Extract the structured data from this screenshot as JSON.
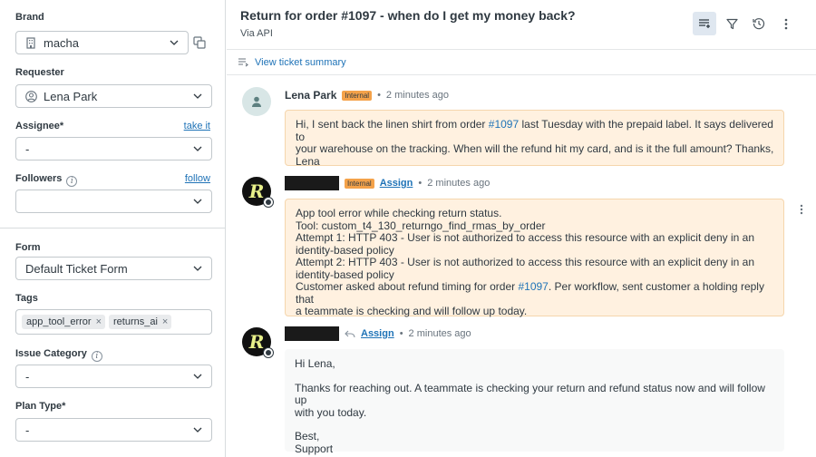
{
  "sidebar": {
    "brand": {
      "label": "Brand",
      "value": "macha"
    },
    "requester": {
      "label": "Requester",
      "value": "Lena Park"
    },
    "assignee": {
      "label": "Assignee*",
      "link": "take it",
      "value": "-"
    },
    "followers": {
      "label": "Followers",
      "link": "follow",
      "value": ""
    },
    "form": {
      "label": "Form",
      "value": "Default Ticket Form"
    },
    "tags": {
      "label": "Tags",
      "items": [
        "app_tool_error",
        "returns_ai"
      ]
    },
    "issue_category": {
      "label": "Issue Category",
      "value": "-"
    },
    "plan_type": {
      "label": "Plan Type*",
      "value": "-"
    }
  },
  "ticket": {
    "title": "Return for order #1097 - when do I get my money back?",
    "via": "Via API",
    "summary_link": "View ticket summary"
  },
  "messages": [
    {
      "author": "Lena Park",
      "badge": "Internal",
      "time": "2 minutes ago",
      "lines": [
        "Hi, I sent back the linen shirt from order ",
        "#1097",
        " last Tuesday with the prepaid label. It says delivered to",
        "your warehouse on the tracking. When will the refund hit my card, and is it the full amount? Thanks,",
        "Lena"
      ]
    },
    {
      "badge": "Internal",
      "assign": "Assign",
      "time": "2 minutes ago",
      "lines": [
        "App tool error while checking return status.",
        "Tool: custom_t4_130_returngo_find_rmas_by_order",
        "Attempt 1: HTTP 403 - User is not authorized to access this resource with an explicit deny in an",
        "identity-based policy",
        "Attempt 2: HTTP 403 - User is not authorized to access this resource with an explicit deny in an",
        "identity-based policy",
        "Customer asked about refund timing for order ",
        "#1097",
        ". Per workflow, sent customer a holding reply that",
        "a teammate is checking and will follow up today."
      ]
    },
    {
      "assign": "Assign",
      "time": "2 minutes ago",
      "lines": [
        "Hi Lena,",
        "Thanks for reaching out. A teammate is checking your return and refund status now and will follow up",
        "with you today.",
        "Best,",
        "Support"
      ]
    }
  ],
  "colors": {
    "link": "#1f73b7",
    "internal_badge": "#f4a24a",
    "internal_bubble": "#fff1e0",
    "active_icon_bg": "#dfe7f0"
  },
  "icons": {
    "brand_copy": "copy-icon",
    "header": [
      "list-add-icon",
      "filter-icon",
      "history-icon",
      "more-vertical-icon"
    ]
  }
}
